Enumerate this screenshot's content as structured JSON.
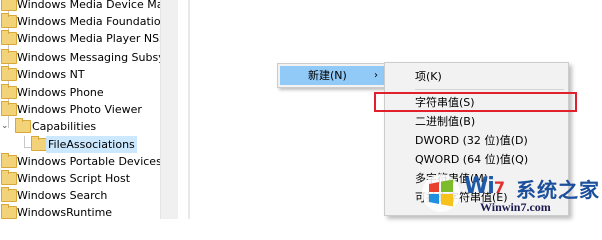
{
  "tree": {
    "items": [
      {
        "label": "Windows Media Device Manager"
      },
      {
        "label": "Windows Media Foundation"
      },
      {
        "label": "Windows Media Player NSS"
      },
      {
        "label": "Windows Messaging Subsystem"
      },
      {
        "label": "Windows NT"
      },
      {
        "label": "Windows Phone"
      },
      {
        "label": "Windows Photo Viewer"
      },
      {
        "label": "Capabilities",
        "expander": "⌄"
      },
      {
        "label": "FileAssociations"
      },
      {
        "label": "Windows Portable Devices"
      },
      {
        "label": "Windows Script Host"
      },
      {
        "label": "Windows Search"
      },
      {
        "label": "WindowsRuntime"
      }
    ]
  },
  "context_menu": {
    "new_label": "新建(N)",
    "arrow": "›"
  },
  "submenu": {
    "items": [
      {
        "label": "项(K)"
      },
      {
        "label": "字符串值(S)"
      },
      {
        "label": "二进制值(B)"
      },
      {
        "label": "DWORD (32 位)值(D)"
      },
      {
        "label": "QWORD (64 位)值(Q)"
      },
      {
        "label": "多字符串值(M)"
      },
      {
        "label": "可扩充字符串值(E)"
      }
    ]
  },
  "watermark": {
    "brand_w": "Wi",
    "brand_num": "7",
    "cn": "系统之家",
    "url": "Winwin7.com"
  },
  "colors": {
    "menu_highlight": "#91c9f7",
    "selection_box": "#e0202a",
    "folder": "#f3d37a"
  }
}
